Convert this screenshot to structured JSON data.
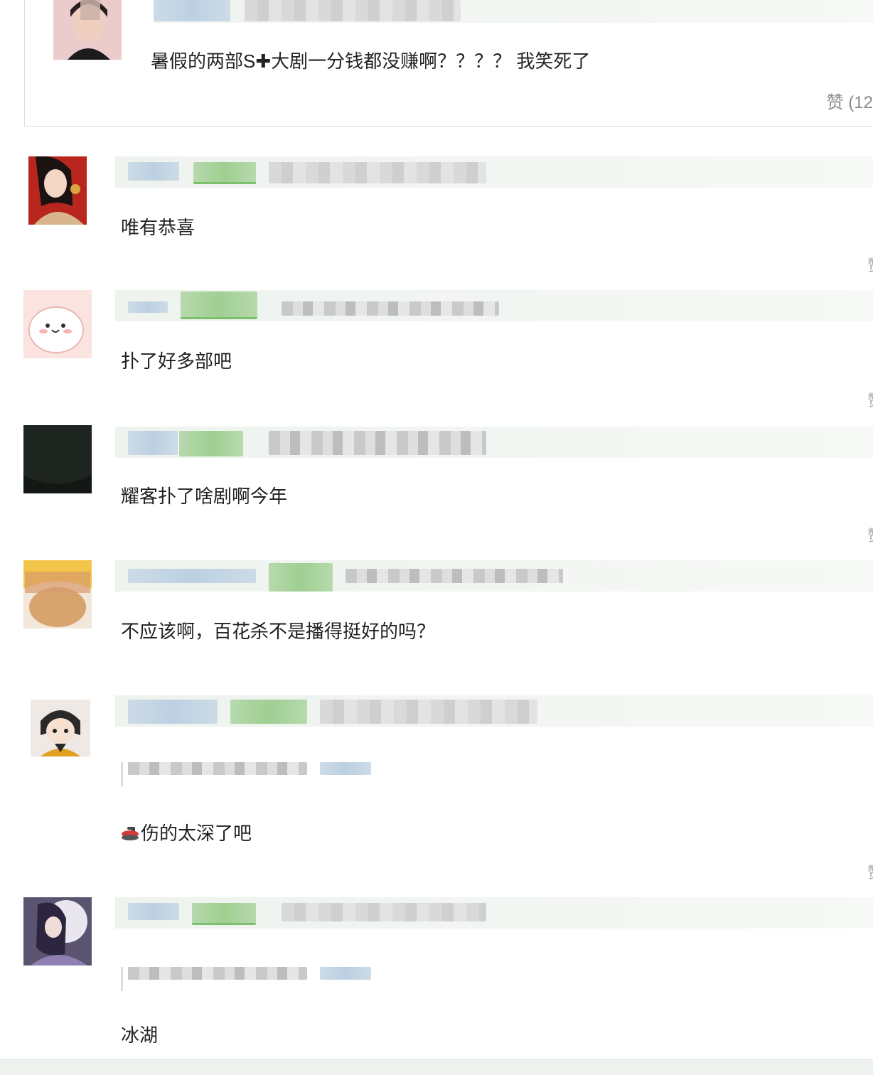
{
  "quoted_comment": {
    "text": "暑假的两部S✚大剧一分钱都没赚啊？？？？ 我笑死了",
    "like_label": "赞 (12"
  },
  "comments": [
    {
      "text": "唯有恭喜"
    },
    {
      "text": "扑了好多部吧"
    },
    {
      "text": "耀客扑了啥剧啊今年"
    },
    {
      "text": "不应该啊，百花杀不是播得挺好的吗？"
    },
    {
      "text": "伤的太深了吧",
      "icon": "curling-stone-icon"
    },
    {
      "text": "冰湖"
    }
  ],
  "colors": {
    "header_band": "#eef3ee",
    "username_blur": "#bcd0e2",
    "badge_green": "#9fcf91",
    "like_gray": "#8a8a8a"
  }
}
